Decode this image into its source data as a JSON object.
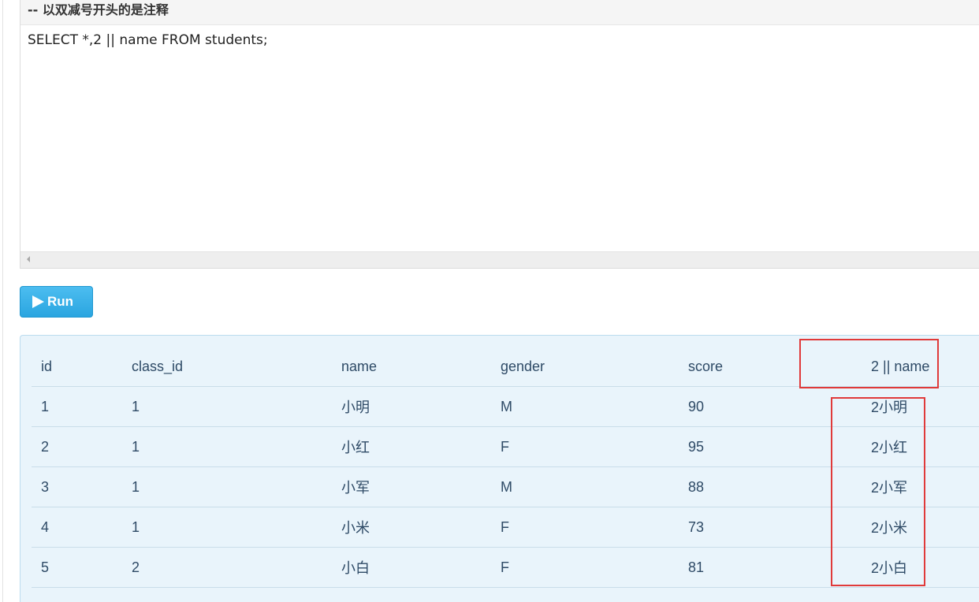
{
  "editor": {
    "comment": "-- 以双减号开头的是注释",
    "code": "SELECT *,2 || name FROM students;"
  },
  "run_button": {
    "label": "Run",
    "icon": "play-icon"
  },
  "results": {
    "columns": [
      "id",
      "class_id",
      "name",
      "gender",
      "score",
      "2 || name"
    ],
    "rows": [
      [
        "1",
        "1",
        "小明",
        "M",
        "90",
        "2小明"
      ],
      [
        "2",
        "1",
        "小红",
        "F",
        "95",
        "2小红"
      ],
      [
        "3",
        "1",
        "小军",
        "M",
        "88",
        "2小军"
      ],
      [
        "4",
        "1",
        "小米",
        "F",
        "73",
        "2小米"
      ],
      [
        "5",
        "2",
        "小白",
        "F",
        "81",
        "2小白"
      ]
    ]
  },
  "colors": {
    "run_button": "#2aa5e0",
    "result_background": "#e9f4fb",
    "highlight_border": "#e03a3a",
    "table_text": "#2e4a66"
  }
}
